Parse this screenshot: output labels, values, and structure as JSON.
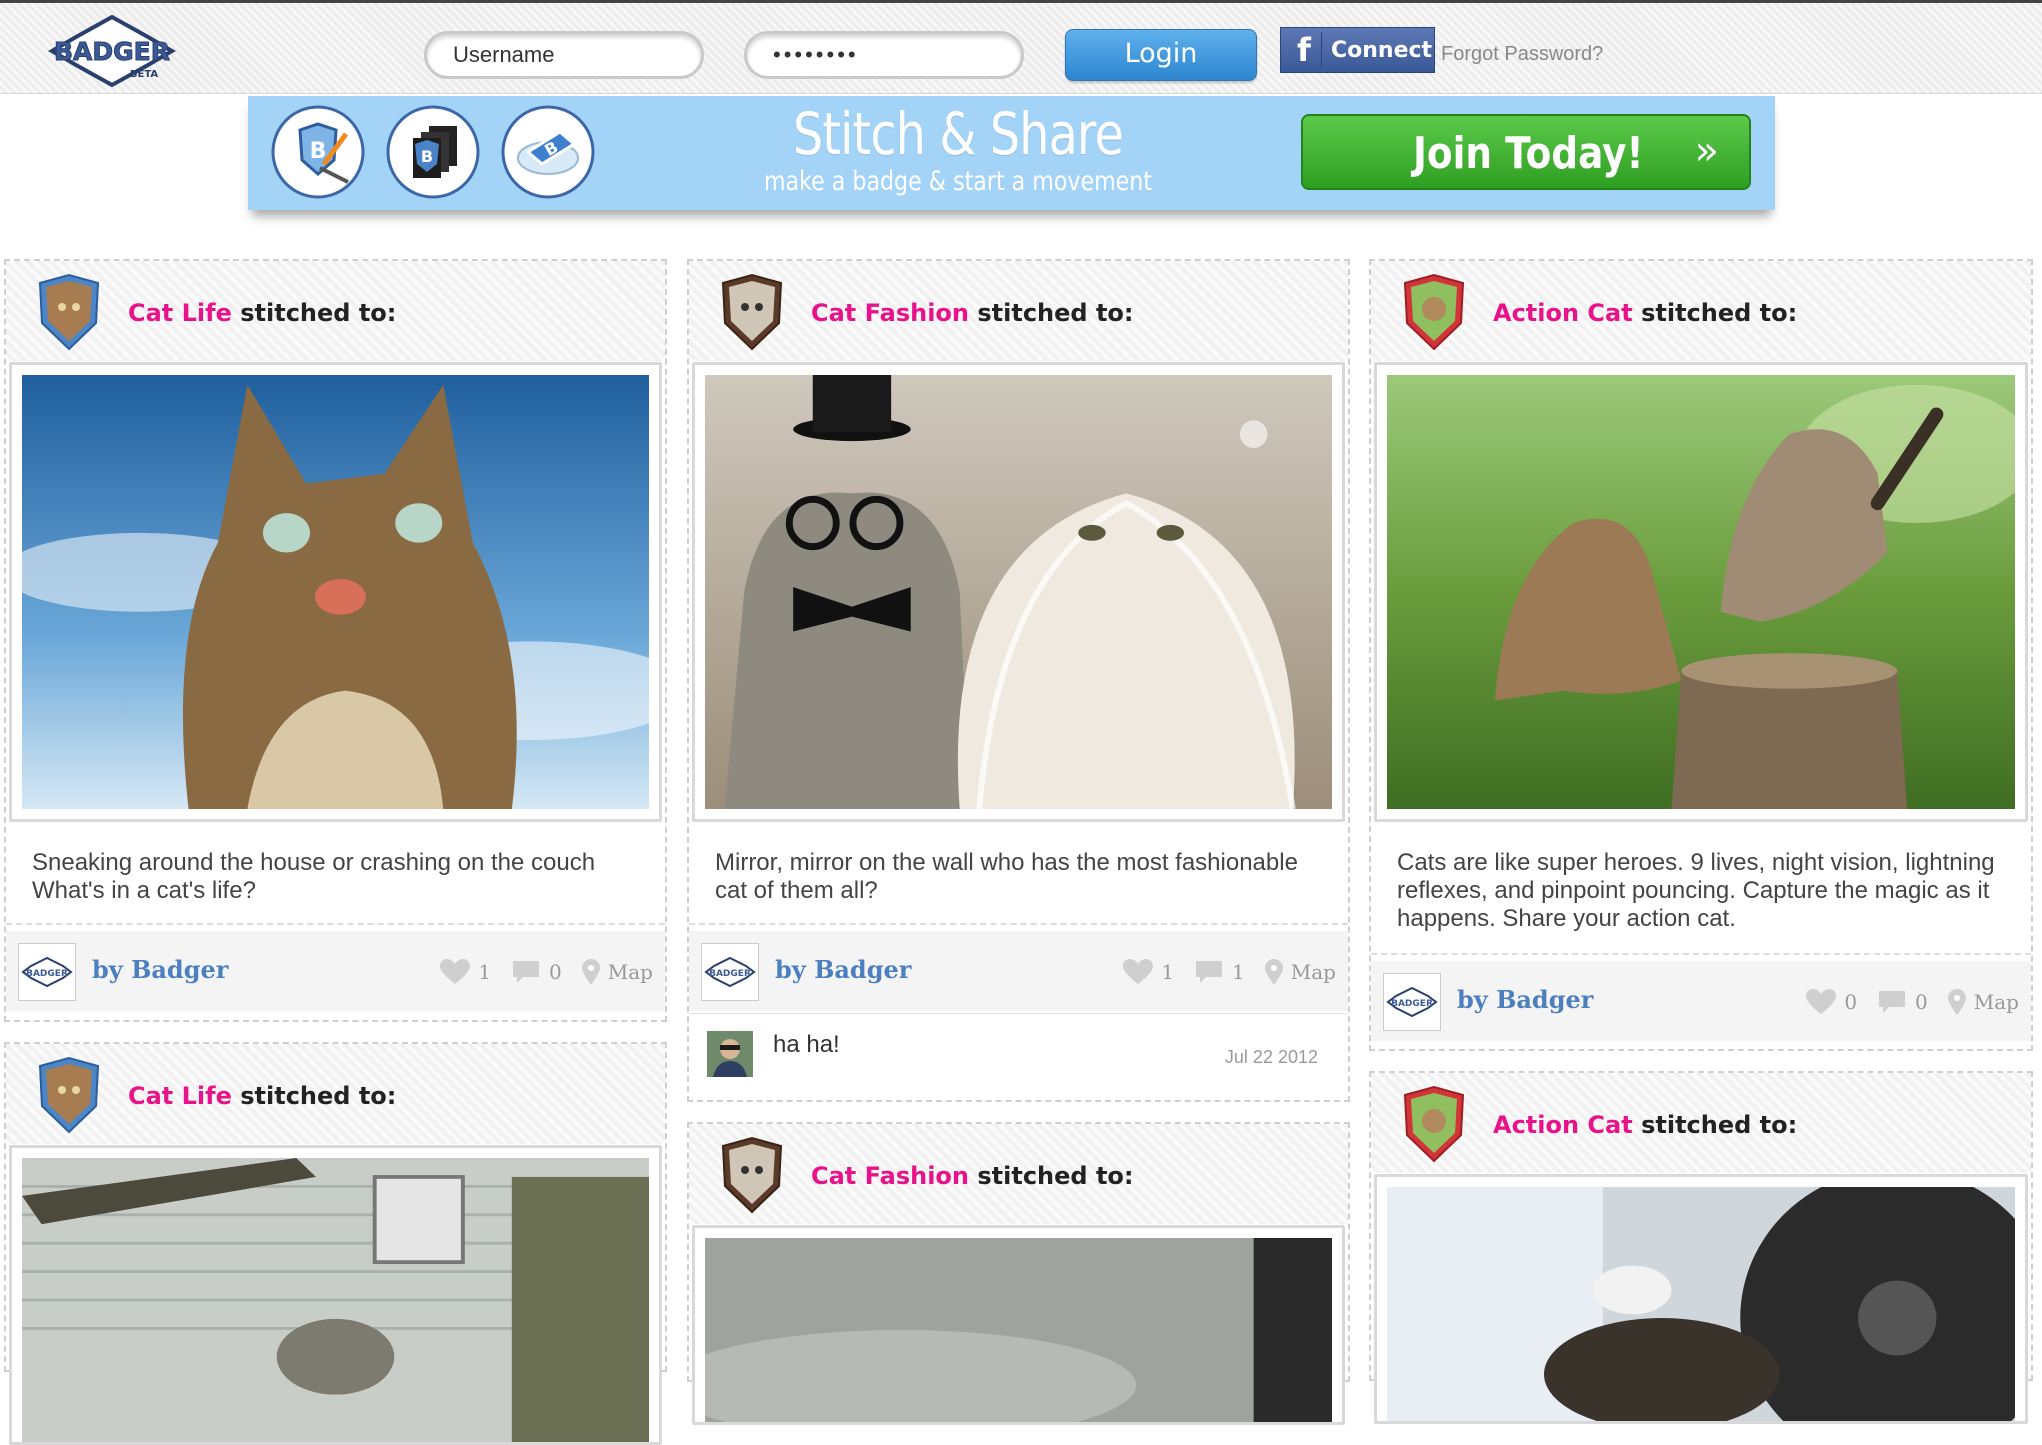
{
  "header": {
    "logo_text": "BADGER",
    "logo_sub": "BETA",
    "username_placeholder": "Username",
    "password_value": "••••••••",
    "login_label": "Login",
    "fb_icon": "f",
    "fb_label": "Connect",
    "forgot_label": "Forgot Password?"
  },
  "banner": {
    "title": "Stitch & Share",
    "subtitle": "make a badge & start a movement",
    "join_label": "Join Today!",
    "join_arrow": "»"
  },
  "cards": [
    {
      "category": "Cat Life",
      "stitched": "stitched to:",
      "description": "Sneaking around the house or crashing on the couch What's in a cat's life?",
      "author": "by Badger",
      "likes": "1",
      "comments": "0",
      "map": "Map"
    },
    {
      "category": "Cat Fashion",
      "stitched": "stitched to:",
      "description": "Mirror, mirror on the wall who has the most fashionable cat of them all?",
      "author": "by Badger",
      "likes": "1",
      "comments": "1",
      "map": "Map",
      "comment_text": "ha ha!",
      "comment_date": "Jul 22 2012"
    },
    {
      "category": "Action Cat",
      "stitched": "stitched to:",
      "description": "Cats are like super heroes. 9 lives, night vision, lightning reflexes, and pinpoint pouncing. Capture the magic as it happens. Share your action cat.",
      "author": "by Badger",
      "likes": "0",
      "comments": "0",
      "map": "Map"
    },
    {
      "category": "Cat Life",
      "stitched": "stitched to:"
    },
    {
      "category": "Cat Fashion",
      "stitched": "stitched to:"
    },
    {
      "category": "Action Cat",
      "stitched": "stitched to:"
    }
  ],
  "colors": {
    "category": "#e8128a",
    "author": "#4b7fbf",
    "banner": "#a3d3f7",
    "join": "#3aad2c"
  }
}
